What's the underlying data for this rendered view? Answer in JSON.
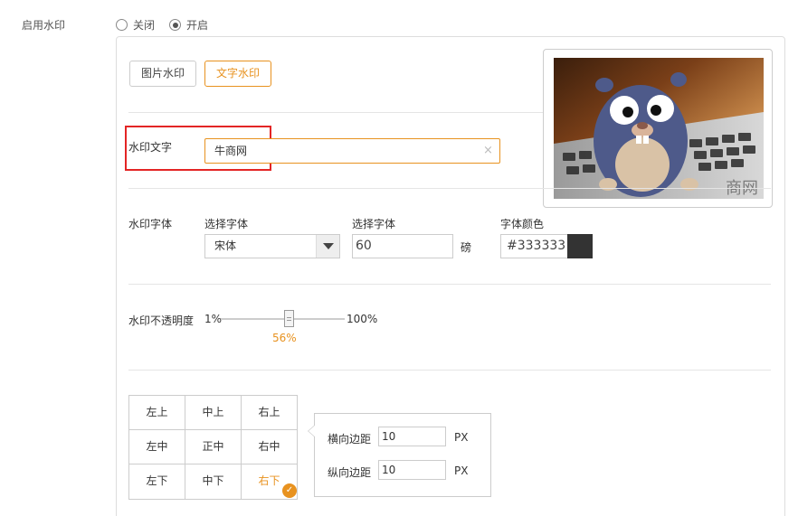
{
  "enable": {
    "label": "启用水印",
    "options": [
      {
        "label": "关闭",
        "checked": false
      },
      {
        "label": "开启",
        "checked": true
      }
    ]
  },
  "type_tabs": [
    {
      "label": "图片水印",
      "active": false
    },
    {
      "label": "文字水印",
      "active": true
    }
  ],
  "watermark_text": {
    "label": "水印文字",
    "value": "牛商网"
  },
  "preview": {
    "overlay_text": "商网"
  },
  "font": {
    "section_label": "水印字体",
    "family_label": "选择字体",
    "family_value": "宋体",
    "size_label": "选择字体",
    "size_value": "60",
    "size_unit": "磅",
    "color_label": "字体颜色",
    "color_value": "#333333"
  },
  "opacity": {
    "label": "水印不透明度",
    "min_label": "1%",
    "max_label": "100%",
    "value_label": "56%",
    "value": 56
  },
  "position": {
    "cells": [
      "左上",
      "中上",
      "右上",
      "左中",
      "正中",
      "右中",
      "左下",
      "中下",
      "右下"
    ],
    "selected": "右下"
  },
  "margins": {
    "horizontal_label": "横向边距",
    "horizontal_value": "10",
    "vertical_label": "纵向边距",
    "vertical_value": "10",
    "unit": "PX"
  },
  "colors": {
    "accent": "#e8921f",
    "highlight_frame": "#e32525",
    "swatch": "#333333"
  }
}
